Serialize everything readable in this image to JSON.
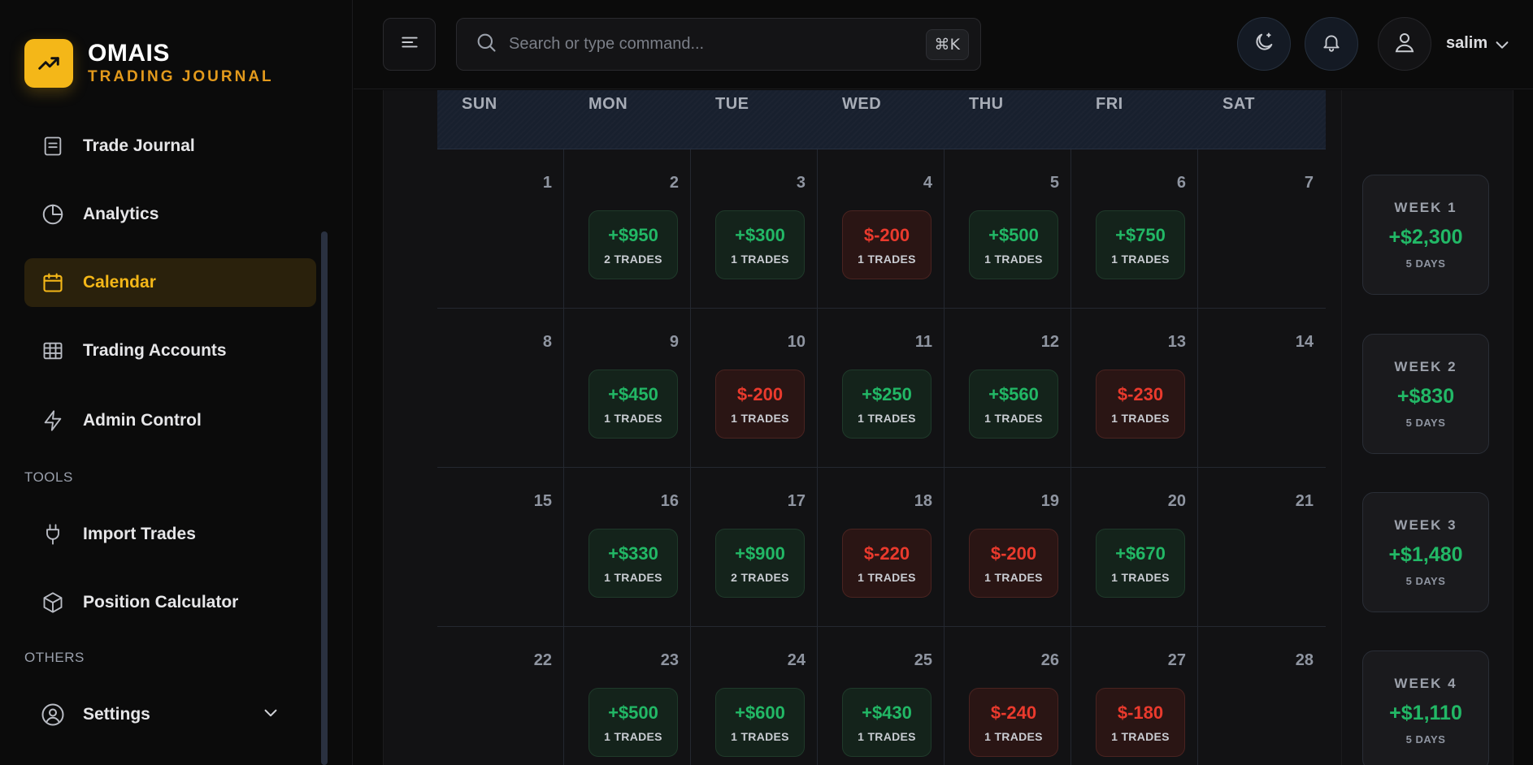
{
  "brand": {
    "title": "OMAIS",
    "subtitle": "TRADING JOURNAL"
  },
  "sidebar": {
    "items": [
      {
        "label": "Trade Journal",
        "icon": "document-list-icon"
      },
      {
        "label": "Analytics",
        "icon": "pie-chart-icon"
      },
      {
        "label": "Calendar",
        "icon": "calendar-icon",
        "active": true
      },
      {
        "label": "Trading Accounts",
        "icon": "table-icon"
      },
      {
        "label": "Admin Control",
        "icon": "bolt-icon"
      }
    ],
    "tools_label": "TOOLS",
    "tools": [
      {
        "label": "Import Trades",
        "icon": "plug-icon"
      },
      {
        "label": "Position Calculator",
        "icon": "cube-icon"
      }
    ],
    "others_label": "OTHERS",
    "others": [
      {
        "label": "Settings",
        "icon": "user-circle-icon"
      }
    ]
  },
  "header": {
    "search_placeholder": "Search or type command...",
    "shortcut": "⌘K",
    "user_name": "salim"
  },
  "calendar": {
    "days_of_week": [
      "SUN",
      "MON",
      "TUE",
      "WED",
      "THU",
      "FRI",
      "SAT"
    ],
    "weeks": [
      {
        "days": [
          {
            "num": "1"
          },
          {
            "num": "2",
            "pnl": "+$950",
            "trades": "2 TRADES",
            "result": "win"
          },
          {
            "num": "3",
            "pnl": "+$300",
            "trades": "1 TRADES",
            "result": "win"
          },
          {
            "num": "4",
            "pnl": "$-200",
            "trades": "1 TRADES",
            "result": "loss"
          },
          {
            "num": "5",
            "pnl": "+$500",
            "trades": "1 TRADES",
            "result": "win"
          },
          {
            "num": "6",
            "pnl": "+$750",
            "trades": "1 TRADES",
            "result": "win"
          },
          {
            "num": "7"
          }
        ]
      },
      {
        "days": [
          {
            "num": "8"
          },
          {
            "num": "9",
            "pnl": "+$450",
            "trades": "1 TRADES",
            "result": "win"
          },
          {
            "num": "10",
            "pnl": "$-200",
            "trades": "1 TRADES",
            "result": "loss"
          },
          {
            "num": "11",
            "pnl": "+$250",
            "trades": "1 TRADES",
            "result": "win"
          },
          {
            "num": "12",
            "pnl": "+$560",
            "trades": "1 TRADES",
            "result": "win"
          },
          {
            "num": "13",
            "pnl": "$-230",
            "trades": "1 TRADES",
            "result": "loss"
          },
          {
            "num": "14"
          }
        ]
      },
      {
        "days": [
          {
            "num": "15"
          },
          {
            "num": "16",
            "pnl": "+$330",
            "trades": "1 TRADES",
            "result": "win"
          },
          {
            "num": "17",
            "pnl": "+$900",
            "trades": "2 TRADES",
            "result": "win"
          },
          {
            "num": "18",
            "pnl": "$-220",
            "trades": "1 TRADES",
            "result": "loss"
          },
          {
            "num": "19",
            "pnl": "$-200",
            "trades": "1 TRADES",
            "result": "loss"
          },
          {
            "num": "20",
            "pnl": "+$670",
            "trades": "1 TRADES",
            "result": "win"
          },
          {
            "num": "21"
          }
        ]
      },
      {
        "days": [
          {
            "num": "22"
          },
          {
            "num": "23",
            "pnl": "+$500",
            "trades": "1 TRADES",
            "result": "win"
          },
          {
            "num": "24",
            "pnl": "+$600",
            "trades": "1 TRADES",
            "result": "win"
          },
          {
            "num": "25",
            "pnl": "+$430",
            "trades": "1 TRADES",
            "result": "win"
          },
          {
            "num": "26",
            "pnl": "$-240",
            "trades": "1 TRADES",
            "result": "loss"
          },
          {
            "num": "27",
            "pnl": "$-180",
            "trades": "1 TRADES",
            "result": "loss"
          },
          {
            "num": "28"
          }
        ]
      }
    ],
    "week_summaries": [
      {
        "label": "WEEK 1",
        "total": "+$2,300",
        "days": "5 DAYS"
      },
      {
        "label": "WEEK 2",
        "total": "+$830",
        "days": "5 DAYS"
      },
      {
        "label": "WEEK 3",
        "total": "+$1,480",
        "days": "5 DAYS"
      },
      {
        "label": "WEEK 4",
        "total": "+$1,110",
        "days": "5 DAYS"
      }
    ]
  },
  "colors": {
    "accent": "#f4b718",
    "profit": "#22b866",
    "loss": "#ea3a2d"
  }
}
